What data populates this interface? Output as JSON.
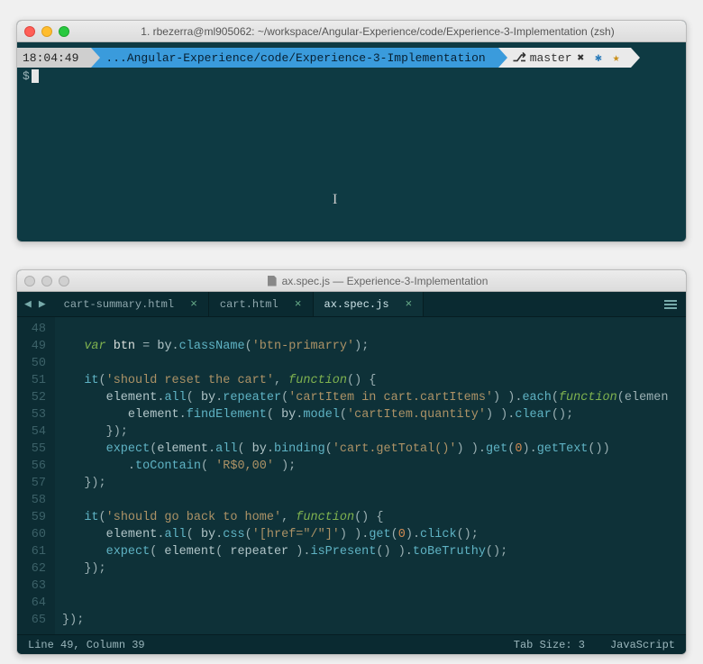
{
  "terminal": {
    "title": "1. rbezerra@ml905062: ~/workspace/Angular-Experience/code/Experience-3-Implementation (zsh)",
    "prompt": {
      "time": "18:04:49",
      "path": "...Angular-Experience/code/Experience-3-Implementation",
      "branch": "master",
      "status_icons": {
        "x": "✖",
        "gear": "✱",
        "star": "★"
      },
      "symbol": "$"
    }
  },
  "editor": {
    "title": "ax.spec.js — Experience-3-Implementation",
    "nav": {
      "back": "◀",
      "forward": "▶"
    },
    "tabs": [
      {
        "label": "cart-summary.html",
        "active": false
      },
      {
        "label": "cart.html",
        "active": false
      },
      {
        "label": "ax.spec.js",
        "active": true
      }
    ],
    "close_glyph": "×",
    "status": {
      "position": "Line 49, Column 39",
      "tab_size": "Tab Size: 3",
      "language": "JavaScript"
    },
    "line_start": 48,
    "line_end": 65,
    "code": {
      "l48": "",
      "l49": {
        "indent": "   ",
        "var": "var",
        "btn": " btn ",
        "eq": "= ",
        "by": "by",
        "className": "className",
        "arg": "'btn-primarry'",
        "tail": ");"
      },
      "l50": "",
      "l51": {
        "indent": "   ",
        "it": "it",
        "op": "(",
        "desc": "'should reset the cart'",
        "c": ", ",
        "fn": "function",
        "tail": "() {"
      },
      "l52": {
        "indent": "      ",
        "el": "element",
        "all": "all",
        "by": "by",
        "rep": "repeater",
        "arg": "'cartItem in cart.cartItems'",
        "mid": ") ).",
        "each": "each",
        "fn": "function",
        "param": "(elemen"
      },
      "l53": {
        "indent": "         ",
        "el": "element",
        "find": "findElement",
        "by": "by",
        "model": "model",
        "arg": "'cartItem.quantity'",
        "mid": ") ).",
        "clear": "clear",
        "tail": "();"
      },
      "l54": {
        "indent": "      ",
        "tail": "});"
      },
      "l55": {
        "indent": "      ",
        "expect": "expect",
        "el": "element",
        "all": "all",
        "by": "by",
        "bind": "binding",
        "arg": "'cart.getTotal()'",
        "mid1": ") ).",
        "get": "get",
        "zero": "0",
        "mid2": ").",
        "gtext": "getText",
        "tail": "())"
      },
      "l56": {
        "indent": "         ",
        "dot": ".",
        "toContain": "toContain",
        "arg": "'R$0,00'",
        "tail": " );"
      },
      "l57": {
        "indent": "   ",
        "tail": "});"
      },
      "l58": "",
      "l59": {
        "indent": "   ",
        "it": "it",
        "desc": "'should go back to home'",
        "fn": "function",
        "tail": "() {"
      },
      "l60": {
        "indent": "      ",
        "el": "element",
        "all": "all",
        "by": "by",
        "css": "css",
        "arg": "'[href=\"/\"]'",
        "mid1": ") ).",
        "get": "get",
        "zero": "0",
        "mid2": ").",
        "click": "click",
        "tail": "();"
      },
      "l61": {
        "indent": "      ",
        "expect": "expect",
        "el": "element",
        "rep": "repeater",
        "mid": " ).",
        "isP": "isPresent",
        "mid2": "() ).",
        "tbt": "toBeTruthy",
        "tail": "();"
      },
      "l62": {
        "indent": "   ",
        "tail": "});"
      },
      "l63": "",
      "l64": "",
      "l65": {
        "tail": "});"
      }
    }
  }
}
